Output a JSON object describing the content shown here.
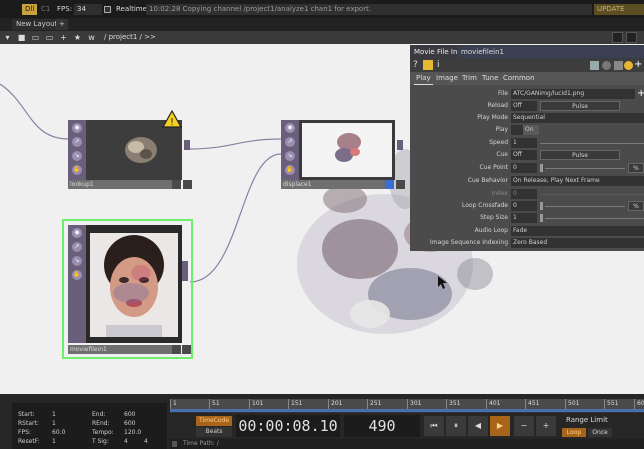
{
  "topbar": {
    "dll_label": "Dll",
    "ctr_label": "C1",
    "fps_label": "FPS:",
    "fps_value": "34",
    "realtime_label": "Realtime",
    "message": "10:02:28 Copying channel /project1/analyze1 chan1 for export.",
    "update_label": "UPDATE"
  },
  "tabs": {
    "layout_label": "New Layout",
    "add_label": "+"
  },
  "pathbar": {
    "icons": [
      "▾",
      "■",
      "▭",
      "▭",
      "+",
      "★",
      "w"
    ],
    "path": "/ project1 / >>"
  },
  "network": {
    "nodes": [
      {
        "name": "lookup1",
        "label": "lookup1"
      },
      {
        "name": "displace1",
        "label": "displace1"
      },
      {
        "name": "moviefilein1",
        "label": "moviefilein1"
      }
    ],
    "warning_glyph": "!"
  },
  "panel": {
    "op_type": "Movie File In",
    "op_name": "moviefilein1",
    "icon_help": "?",
    "icon_info": "i",
    "tabs": [
      "Play",
      "Image",
      "Trim",
      "Tune",
      "Common"
    ],
    "params": {
      "file": {
        "label": "File",
        "value": "ATC/GANimg/lucid1.png"
      },
      "reload": {
        "label": "Reload",
        "value": "Off",
        "button": "Pulse"
      },
      "play_mode": {
        "label": "Play Mode",
        "value": "Sequential"
      },
      "play": {
        "label": "Play",
        "value": "On"
      },
      "speed": {
        "label": "Speed",
        "value": "1"
      },
      "cue": {
        "label": "Cue",
        "value": "Off",
        "button": "Pulse"
      },
      "cue_point": {
        "label": "Cue Point",
        "value": "0"
      },
      "cue_behavior": {
        "label": "Cue Behavior",
        "value": "On Release, Play Next Frame"
      },
      "index": {
        "label": "Index",
        "value": "0"
      },
      "loop_crossfade": {
        "label": "Loop Crossfade",
        "value": "0"
      },
      "step_size": {
        "label": "Step Size",
        "value": "1"
      },
      "audio_loop": {
        "label": "Audio Loop",
        "value": "Fade"
      },
      "image_seq_indexing": {
        "label": "Image Sequence Indexing",
        "value": "Zero Based"
      }
    }
  },
  "timeline": {
    "info": {
      "start": {
        "label": "Start:",
        "value": "1"
      },
      "end": {
        "label": "End:",
        "value": "600"
      },
      "rstart": {
        "label": "RStart:",
        "value": "1"
      },
      "rend": {
        "label": "REnd:",
        "value": "600"
      },
      "fps": {
        "label": "FPS:",
        "value": "60.0"
      },
      "tempo": {
        "label": "Tempo:",
        "value": "120.0"
      },
      "resetf": {
        "label": "ResetF:",
        "value": "1"
      },
      "tsig": {
        "label": "T Sig:",
        "value1": "4",
        "value2": "4"
      }
    },
    "ruler_ticks": [
      "1",
      "51",
      "101",
      "151",
      "201",
      "251",
      "301",
      "351",
      "401",
      "451",
      "501",
      "551",
      "60"
    ],
    "timecode_btn": "TimeCode",
    "beats_btn": "Beats",
    "timecode": "00:00:08.10",
    "frame": "490",
    "transport": [
      "⏮",
      "⏸",
      "◀",
      "▶",
      "−",
      "+"
    ],
    "range_limit_label": "Range Limit",
    "loop_btn": "Loop",
    "once_btn": "Once",
    "time_path_label": "Time Path: /"
  },
  "colors": {
    "accent_orange": "#a86418",
    "node_purple": "#6a5f7a",
    "selected_green": "#6cf06c",
    "panel_bg": "#4b4b4b"
  }
}
